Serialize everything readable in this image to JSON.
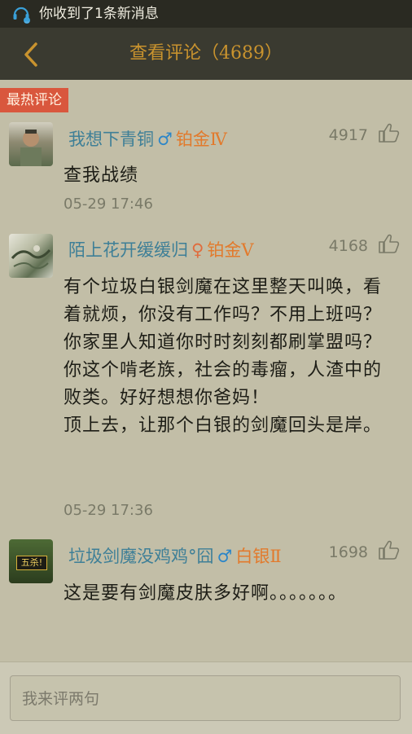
{
  "status": {
    "notification": "你收到了1条新消息"
  },
  "header": {
    "title": "查看评论（4689）"
  },
  "section": {
    "label": "最热评论"
  },
  "comments": [
    {
      "username": "我想下青铜",
      "gender": "♂",
      "rank": "铂金Ⅳ",
      "likes": "4917",
      "text": "查我战绩",
      "time": "05-29 17:46"
    },
    {
      "username": "陌上花开缓缓归",
      "gender": "♀",
      "rank": "铂金Ⅴ",
      "likes": "4168",
      "text": "有个垃圾白银剑魔在这里整天叫唤，看着就烦，你没有工作吗？不用上班吗？你家里人知道你时时刻刻都刷掌盟吗？你这个啃老族，社会的毒瘤，人渣中的败类。好好想想你爸妈！\n顶上去，让那个白银的剑魔回头是岸。",
      "time": "05-29 17:36"
    },
    {
      "username": "垃圾剑魔没鸡鸡°囧",
      "gender": "♂",
      "rank": "白银Ⅱ",
      "likes": "1698",
      "avatar_text": "五杀!",
      "text": "这是要有剑魔皮肤多好啊。。。。。。。",
      "time": ""
    }
  ],
  "composer": {
    "placeholder": "我来评两句"
  },
  "colors": {
    "accent": "#c9932e",
    "hot_label": "#d9573d",
    "username": "#3e7f97",
    "rank": "#e27a2c"
  },
  "icons": [
    "notification-bell-icon",
    "back-arrow-icon",
    "thumbs-up-icon",
    "male-icon",
    "female-icon"
  ]
}
